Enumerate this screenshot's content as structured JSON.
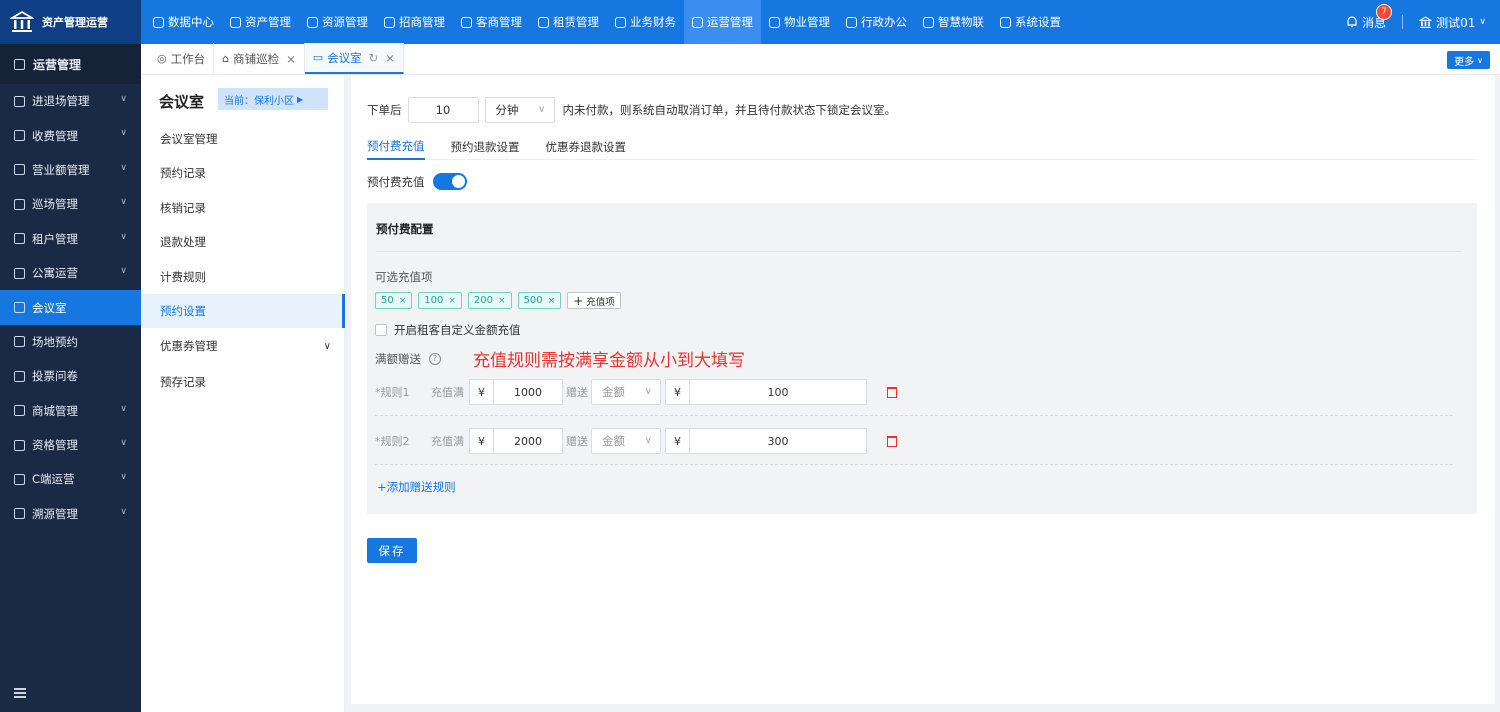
{
  "brand": {
    "name": "资产管理运营"
  },
  "topnav": [
    {
      "label": "数据中心",
      "icon": "dashboard-icon",
      "active": false
    },
    {
      "label": "资产管理",
      "icon": "cube-icon",
      "active": false
    },
    {
      "label": "资源管理",
      "icon": "document-icon",
      "active": false
    },
    {
      "label": "招商管理",
      "icon": "tag-icon",
      "active": false
    },
    {
      "label": "客商管理",
      "icon": "users-icon",
      "active": false
    },
    {
      "label": "租赁管理",
      "icon": "home-icon",
      "active": false
    },
    {
      "label": "业务财务",
      "icon": "coin-icon",
      "active": false
    },
    {
      "label": "运营管理",
      "icon": "grid-icon",
      "active": true
    },
    {
      "label": "物业管理",
      "icon": "building-icon",
      "active": false
    },
    {
      "label": "行政办公",
      "icon": "monitor-icon",
      "active": false
    },
    {
      "label": "智慧物联",
      "icon": "atom-icon",
      "active": false
    },
    {
      "label": "系统设置",
      "icon": "gear-icon",
      "active": false
    }
  ],
  "header_right": {
    "messages_label": "消息",
    "messages_count": "7",
    "user_label": "测试01"
  },
  "sidebar": {
    "header": "运营管理",
    "items": [
      {
        "label": "进退场管理",
        "has_chevron": true
      },
      {
        "label": "收费管理",
        "has_chevron": true
      },
      {
        "label": "营业额管理",
        "has_chevron": true
      },
      {
        "label": "巡场管理",
        "has_chevron": true
      },
      {
        "label": "租户管理",
        "has_chevron": true
      },
      {
        "label": "公寓运营",
        "has_chevron": true
      },
      {
        "label": "会议室",
        "has_chevron": false,
        "active": true
      },
      {
        "label": "场地预约",
        "has_chevron": false
      },
      {
        "label": "投票问卷",
        "has_chevron": false
      },
      {
        "label": "商城管理",
        "has_chevron": true
      },
      {
        "label": "资格管理",
        "has_chevron": true
      },
      {
        "label": "C端运营",
        "has_chevron": true
      },
      {
        "label": "溯源管理",
        "has_chevron": true
      }
    ]
  },
  "tabs": [
    {
      "label": "工作台",
      "closable": false,
      "active": false
    },
    {
      "label": "商铺巡检",
      "closable": true,
      "active": false
    },
    {
      "label": "会议室",
      "closable": true,
      "active": true
    }
  ],
  "more_label": "更多",
  "subside": {
    "title": "会议室",
    "scope": "当前：保利小区",
    "items": [
      {
        "label": "会议室管理"
      },
      {
        "label": "预约记录"
      },
      {
        "label": "核销记录"
      },
      {
        "label": "退款处理"
      },
      {
        "label": "计费规则"
      },
      {
        "label": "预约设置",
        "active": true
      },
      {
        "label": "优惠券管理",
        "has_chevron": true
      },
      {
        "label": "预存记录"
      }
    ]
  },
  "main": {
    "order_prefix": "下单后",
    "order_minutes": "10",
    "order_unit": "分钟",
    "order_suffix": "内未付款，则系统自动取消订单，并且待付款状态下锁定会议室。",
    "subtabs": [
      {
        "label": "预付费充值",
        "active": true
      },
      {
        "label": "预约退款设置",
        "active": false
      },
      {
        "label": "优惠券退款设置",
        "active": false
      }
    ],
    "toggle_label": "预付费充值",
    "config_title": "预付费配置",
    "options_label": "可选充值项",
    "chips": [
      "50",
      "100",
      "200",
      "500"
    ],
    "add_chip_label": "充值项",
    "custom_amount_label": "开启租客自定义金额充值",
    "gift_label": "满额赠送",
    "note": "充值规则需按满享金额从小到大填写",
    "rules": [
      {
        "name": "*规则1",
        "full_label": "充值满",
        "currency": "¥",
        "threshold": "1000",
        "gift_label": "赠送",
        "gift_type": "金额",
        "gift_amount": "100"
      },
      {
        "name": "*规则2",
        "full_label": "充值满",
        "currency": "¥",
        "threshold": "2000",
        "gift_label": "赠送",
        "gift_type": "金额",
        "gift_amount": "300"
      }
    ],
    "add_rule_label": "+添加赠送规则",
    "save_label": "保存"
  },
  "colors": {
    "primary": "#1677e0",
    "sidebar": "#1b2a44",
    "danger": "#f0322b",
    "chip": "#1aa79a"
  }
}
